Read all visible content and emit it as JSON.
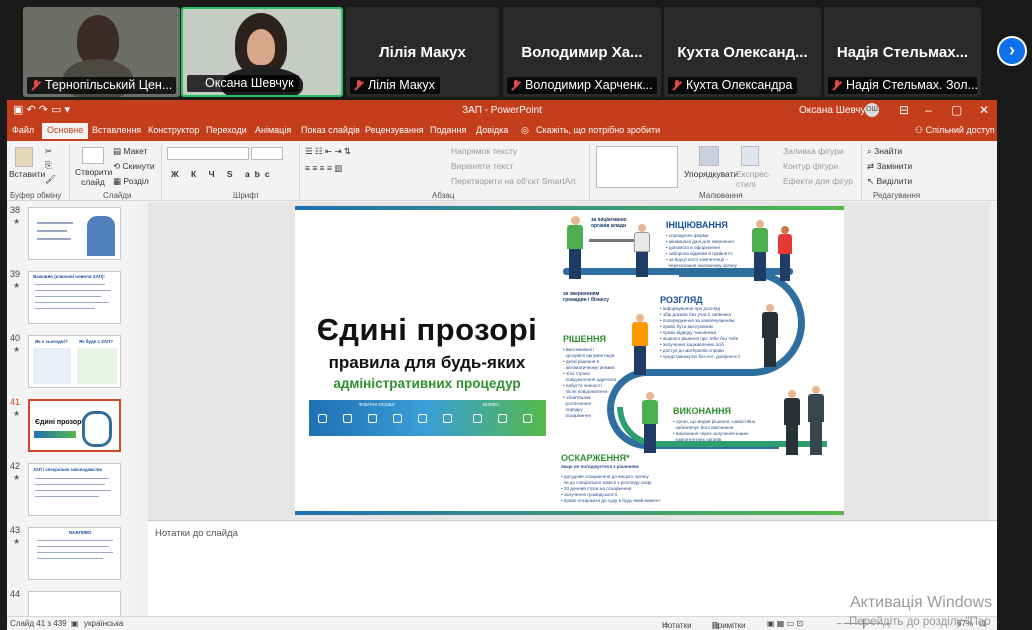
{
  "participants": [
    {
      "name": "Тернопільський Цен...",
      "video": true
    },
    {
      "name": "Оксана Шевчук",
      "video": true,
      "active": true
    },
    {
      "name": "Лілія Макух",
      "display": "Лілія Макух"
    },
    {
      "name": "Володимир Харченк...",
      "display": "Володимир Ха..."
    },
    {
      "name": "Кухта Олександра",
      "display": "Кухта Олександ..."
    },
    {
      "name": "Надія Стельмах. Зол...",
      "display": "Надія Стельмах..."
    }
  ],
  "app": {
    "title": "ЗАП - PowerPoint",
    "user": "Оксана Шевчук",
    "user_initials": "ОШ"
  },
  "tabs": [
    "Файл",
    "Основне",
    "Вставлення",
    "Конструктор",
    "Переходи",
    "Анімація",
    "Показ слайдів",
    "Рецензування",
    "Подання",
    "Довідка"
  ],
  "tell_me": "Скажіть, що потрібно зробити",
  "share": "Спільний доступ",
  "ribbon": {
    "paste": "Вставити",
    "new_slide": "Створити слайд",
    "layout": "Макет",
    "reset": "Скинути",
    "section": "Розділ",
    "text_direction": "Напрямок тексту",
    "align_text": "Вирівняти текст",
    "smartart": "Перетворити на об'єкт SmartArt",
    "arrange": "Упорядкувати",
    "quick_styles": "Експрес-стилі",
    "shape_fill": "Заливка фігури",
    "shape_outline": "Контур фігури",
    "shape_effects": "Ефекти для фігур",
    "find": "Знайти",
    "replace": "Замінити",
    "select": "Виділити",
    "groups": [
      "Буфер обміну",
      "Слайди",
      "Шрифт",
      "Абзац",
      "Малювання",
      "Редагування"
    ]
  },
  "thumbnails": [
    {
      "num": "38"
    },
    {
      "num": "39",
      "heading": "Важливо (ключові новели ЗАП):"
    },
    {
      "num": "40",
      "heading": "Як є сьогодні?",
      "heading2": "Як буде з ЗАП?"
    },
    {
      "num": "41",
      "selected": true,
      "heading": "Єдині прозорі"
    },
    {
      "num": "42",
      "heading": "ЗАП і спеціальне законодавство"
    },
    {
      "num": "43",
      "heading": "ВАЖЛИВО"
    },
    {
      "num": "44"
    }
  ],
  "slide": {
    "title_line1": "Єдині прозорі",
    "title_line2": "правила для будь-яких",
    "title_line3": "адміністративних процедур",
    "band_left": "ФІЗИЧНІ ОСОБИ",
    "band_right": "БІЗНЕС",
    "initiative_label": "за ініціативою\nорганів влади",
    "request_label": "за зверненням\nгромадян і бізнесу",
    "stages": [
      {
        "title": "ІНІЦІЮВАННЯ",
        "items": "• спрощення форми\n• мінімальні дані для звернення\n• допомога в оформленні\n• заборона відмови в прийнятті\n• за відсутності компетенції –\n  пересилання належному органу"
      },
      {
        "title": "РОЗГЛЯД",
        "items": "• інформування про розгляд\n• збір доказів без участі заявника\n• попередження за замовчуванням\n• право бути вислуханим\n• право відводу чиновника\n• жодного рішення про тебе без тебе\n• залучення зацікавлених осіб\n• доступ до матеріалів справи\n• представництво без нот. довіреності"
      },
      {
        "title": "РІШЕННЯ",
        "items": "• вмотивовані і\n  зрозумілі аргументація\n• деякі рішення в\n  автоматичному режимі\n• чіткі строки\n  повідомлення адресата\n• набуття чинності\n  після повідомлення\n• обов'язкове\n  роз'яснення\n  порядку\n  оскарження"
      },
      {
        "title": "ВИКОНАННЯ",
        "items": "• орган, що видав рішення, самостійно\n  забезпечує його виконання\n• виконання через залучення інших\n  компетентних органів"
      },
      {
        "title": "ОСКАРЖЕННЯ*",
        "subtitle": "якщо не погоджуєтеся з рішенням",
        "items": "• досудове оскарження до вищого органу\n  чи до спеціальної комісії з розгляду скарг\n• 30 денний строк на оскарження\n• залучення громадськості\n• право оскаржити до суду в будь-який момент"
      }
    ]
  },
  "notes_placeholder": "Нотатки до слайда",
  "status": {
    "slide_of": "Слайд 41 з 439",
    "language": "українська",
    "notes": "Нотатки",
    "comments": "Примітки",
    "zoom": "67%"
  },
  "windows_watermark": {
    "line1": "Активація Windows",
    "line2": "Перейдіть до розділу \"Пар"
  },
  "colors": {
    "ppt_red": "#c43e1c",
    "zoom_blue": "#0e71eb",
    "slide_blue": "#1a4f9c",
    "slide_green": "#2f8f2f"
  }
}
